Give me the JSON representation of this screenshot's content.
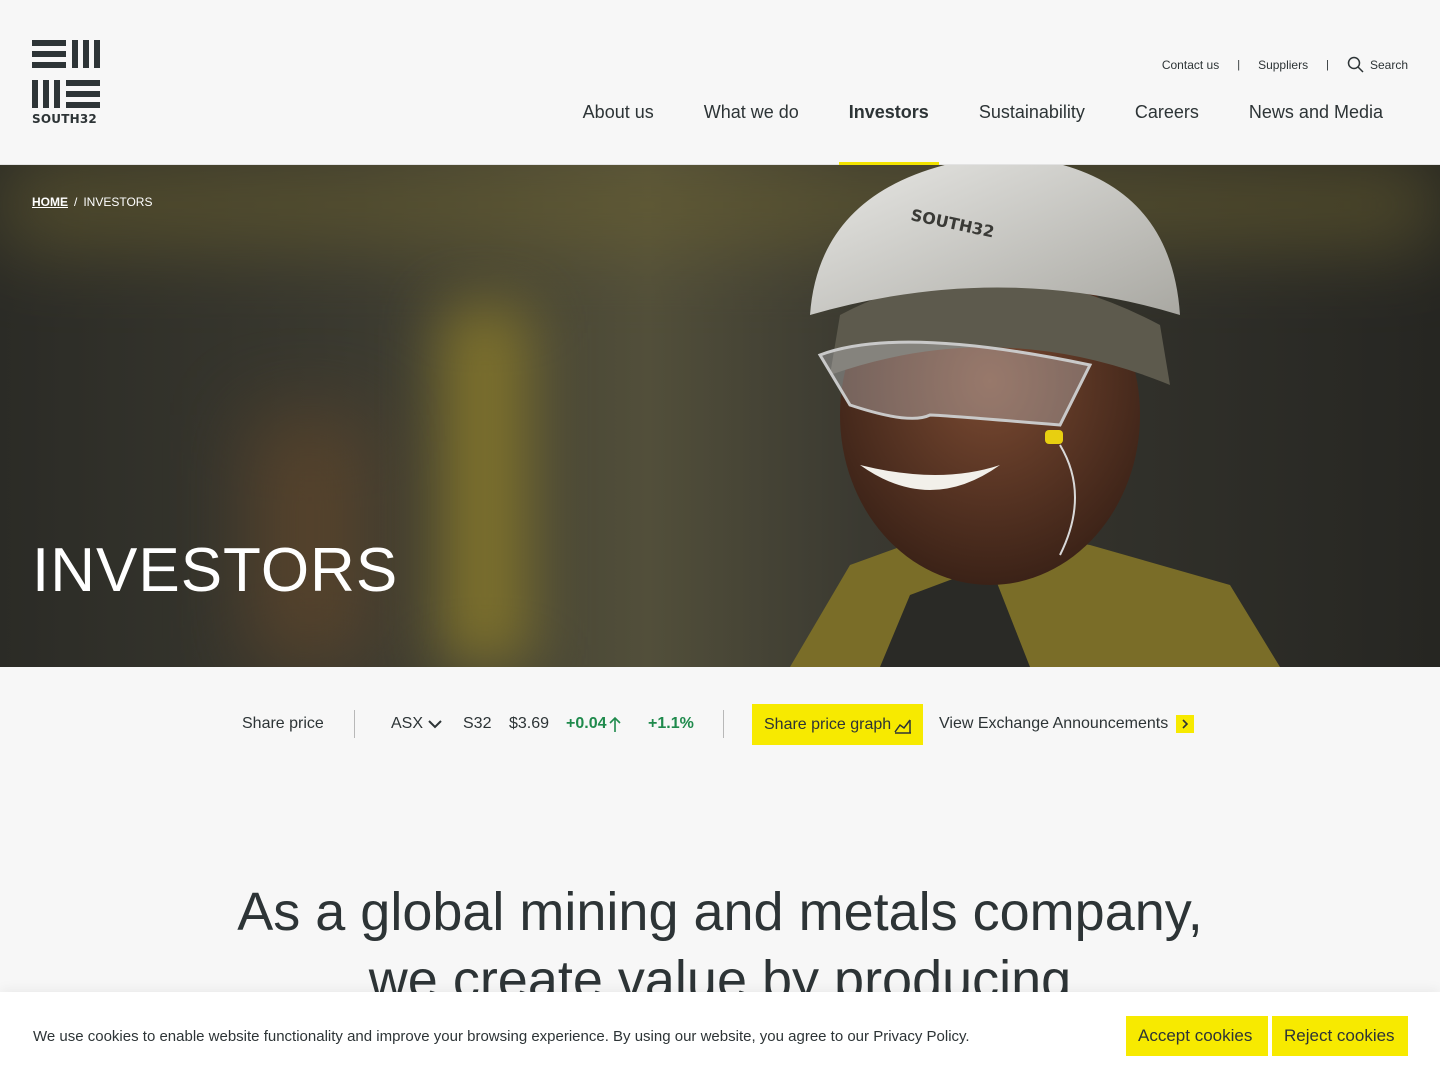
{
  "header": {
    "logo_text": "SOUTH32",
    "utility": {
      "contact": "Contact us",
      "suppliers": "Suppliers",
      "separator": "|",
      "search": "Search"
    },
    "nav": [
      {
        "label": "About us"
      },
      {
        "label": "What we do"
      },
      {
        "label": "Investors",
        "active": true
      },
      {
        "label": "Sustainability"
      },
      {
        "label": "Careers"
      },
      {
        "label": "News and Media"
      }
    ]
  },
  "hero": {
    "breadcrumb": {
      "home": "HOME",
      "separator": "/",
      "current": "INVESTORS"
    },
    "title": "INVESTORS",
    "helmet_text": "SOUTH32"
  },
  "share_price": {
    "label": "Share price",
    "exchange": "ASX",
    "ticker": "S32",
    "price": "$3.69",
    "change": "+0.04",
    "change_percent": "+1.1%",
    "graph_button": "Share price graph",
    "announcements_link": "View Exchange Announcements"
  },
  "intro": {
    "line1": "As a global mining and metals company,",
    "line2": "we create value by producing"
  },
  "cookie": {
    "message": "We use cookies to enable website functionality and improve your browsing experience. By using our website, you agree to our Privacy Policy.",
    "accept": "Accept cookies",
    "reject": "Reject cookies"
  },
  "colors": {
    "accent_yellow": "#f7ea00",
    "positive_green": "#1f8a4c",
    "text_dark": "#2d3436",
    "background": "#f7f7f7"
  },
  "icons": [
    "search-icon",
    "chevron-down-icon",
    "arrow-up-icon",
    "chart-icon",
    "chevron-right-icon"
  ]
}
